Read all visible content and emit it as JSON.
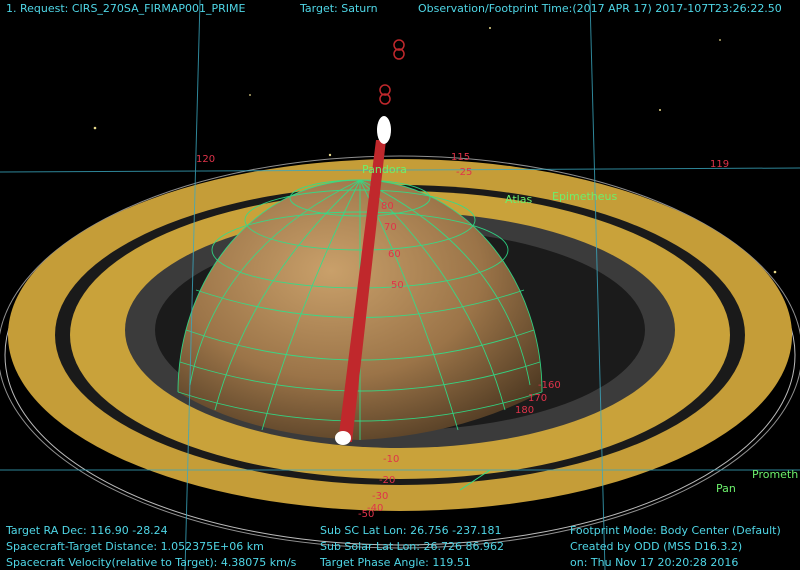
{
  "header": {
    "request": "1. Request: CIRS_270SA_FIRMAP001_PRIME",
    "target": "Target: Saturn",
    "time": "Observation/Footprint Time:(2017 APR 17) 2017-107T23:26:22.50"
  },
  "labels": {
    "pandora": "Pandora",
    "atlas": "Atlas",
    "epimetheus": "Epimetheus",
    "pan": "Pan",
    "prometheus": "Prometh"
  },
  "grid_labels": [
    "120",
    "115",
    "-25",
    "119",
    "80",
    "70",
    "60",
    "50",
    "-10",
    "-20",
    "-30",
    "-40",
    "-50",
    "-160",
    "170",
    "180"
  ],
  "footer": {
    "ra_dec": "Target RA Dec: 116.90  -28.24",
    "distance": "Spacecraft-Target Distance: 1.052375E+06 km",
    "velocity": "Spacecraft Velocity(relative to Target): 4.38075 km/s",
    "sub_sc": "Sub SC Lat Lon: 26.756 -237.181",
    "sub_solar": "Sub Solar Lat Lon: 26.726  86.962",
    "phase": "Target Phase Angle: 119.51",
    "footprint_mode": "Footprint Mode: Body Center (Default)",
    "created_by": "Created by ODD (MSS D16.3.2)",
    "created_on": "on: Thu Nov 17 20:20:28 2016"
  },
  "colors": {
    "hud_text": "#4fd6e6",
    "grid": "#2ee08a",
    "footprint": "#c0282c",
    "ring_gold": "#c9a23a",
    "ring_gray": "#3a3a3a",
    "moon_label": "#6cf06c",
    "grid_label": "#e0334a"
  }
}
